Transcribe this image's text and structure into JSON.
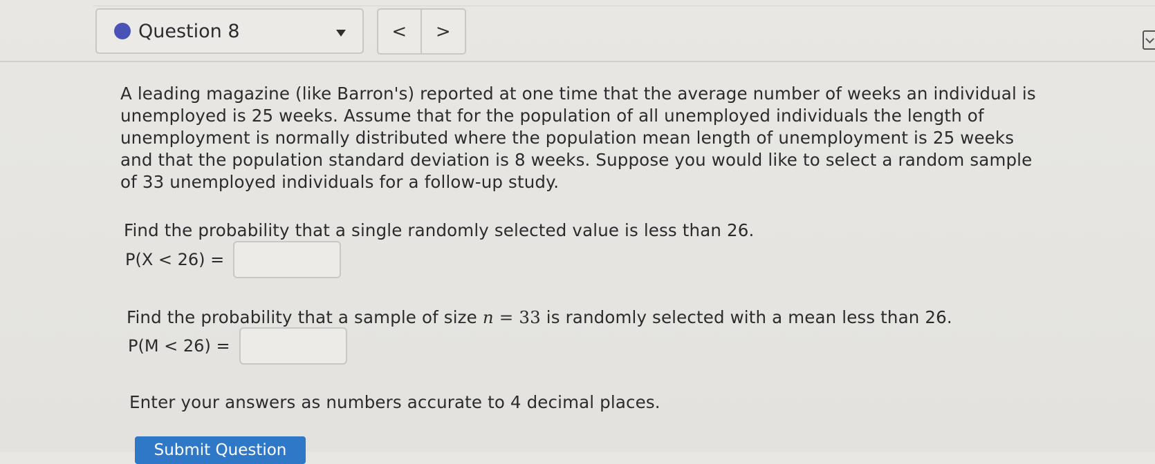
{
  "header": {
    "question_label": "Question 8",
    "status_color": "#4a52b8",
    "dropdown_icon": "caret-down-icon",
    "prev_symbol": "<",
    "next_symbol": ">"
  },
  "problem": {
    "text": "A leading magazine (like Barron's) reported at one time that the average number of weeks an individual is unemployed is 25 weeks. Assume that for the population of all unemployed individuals the length of unemployment is normally distributed where the population mean length of unemployment is 25 weeks and that the population standard deviation is 8 weeks. Suppose you would like to select a random sample of 33 unemployed individuals for a follow-up study."
  },
  "part1": {
    "prompt": "Find the probability that a single randomly selected value is less than 26.",
    "label": "P(X < 26) =",
    "value": ""
  },
  "part2": {
    "prompt_start": "Find the probability that a sample of size ",
    "math_var": "n",
    "math_eq": " = ",
    "math_value": "33",
    "prompt_end": " is randomly selected with a mean less than 26.",
    "label": "P(M < 26) =",
    "value": ""
  },
  "instructions": "Enter your answers as numbers accurate to 4 decimal places.",
  "submit_label": "Submit Question",
  "colors": {
    "accent": "#2f78c7",
    "status_dot": "#4a52b8"
  }
}
